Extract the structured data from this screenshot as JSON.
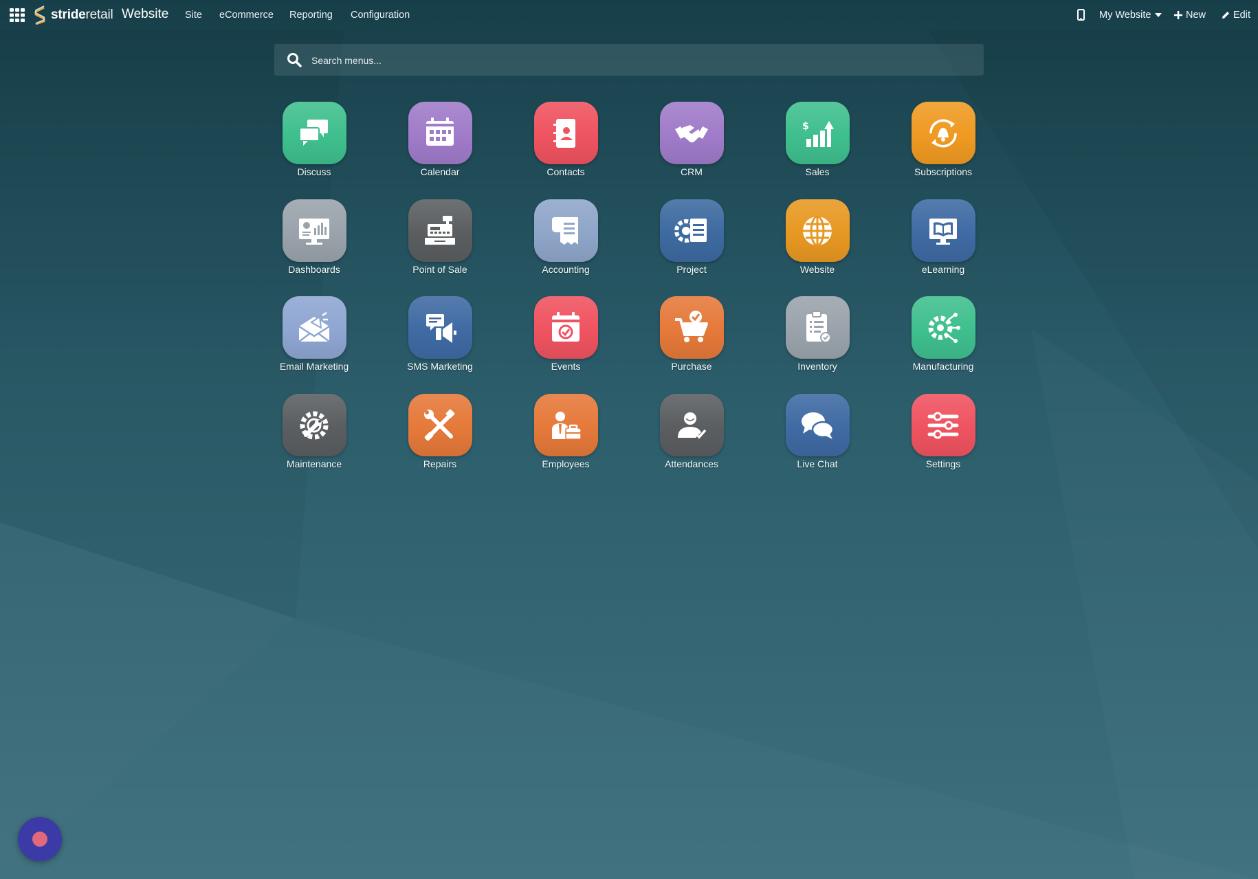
{
  "brand": {
    "logo_bold": "stride",
    "logo_light": "retail",
    "app_name": "Website"
  },
  "nav": [
    "Site",
    "eCommerce",
    "Reporting",
    "Configuration"
  ],
  "toolbar": {
    "website_label": "My Website",
    "new_label": "New",
    "edit_label": "Edit"
  },
  "search": {
    "placeholder": "Search menus...",
    "value": ""
  },
  "apps": [
    {
      "label": "Discuss",
      "color": "#3fbf8e",
      "icon": "chat-bubbles-icon"
    },
    {
      "label": "Calendar",
      "color": "#a07bc9",
      "icon": "calendar-icon"
    },
    {
      "label": "Contacts",
      "color": "#ef5360",
      "icon": "address-book-icon"
    },
    {
      "label": "CRM",
      "color": "#a07bc9",
      "icon": "handshake-icon"
    },
    {
      "label": "Sales",
      "color": "#3fbf8e",
      "icon": "sales-chart-icon"
    },
    {
      "label": "Subscriptions",
      "color": "#ef9a22",
      "icon": "bell-refresh-icon"
    },
    {
      "label": "Dashboards",
      "color": "#9aa3ab",
      "icon": "monitor-chart-icon"
    },
    {
      "label": "Point of Sale",
      "color": "#5a5e61",
      "icon": "cash-register-icon"
    },
    {
      "label": "Accounting",
      "color": "#8fa6c9",
      "icon": "receipt-icon"
    },
    {
      "label": "Project",
      "color": "#3d6aa0",
      "icon": "gear-document-icon"
    },
    {
      "label": "Website",
      "color": "#e89822",
      "icon": "globe-icon"
    },
    {
      "label": "eLearning",
      "color": "#3f6aa3",
      "icon": "book-monitor-icon"
    },
    {
      "label": "Email Marketing",
      "color": "#8ea6d2",
      "icon": "envelope-megaphone-icon"
    },
    {
      "label": "SMS Marketing",
      "color": "#3f6aa3",
      "icon": "sms-megaphone-icon"
    },
    {
      "label": "Events",
      "color": "#ef5360",
      "icon": "event-calendar-icon"
    },
    {
      "label": "Purchase",
      "color": "#e5793a",
      "icon": "cart-check-icon"
    },
    {
      "label": "Inventory",
      "color": "#9aa3ab",
      "icon": "clipboard-check-icon"
    },
    {
      "label": "Manufacturing",
      "color": "#3fbf8e",
      "icon": "gear-circuit-icon"
    },
    {
      "label": "Maintenance",
      "color": "#5a5e61",
      "icon": "wrench-gear-icon"
    },
    {
      "label": "Repairs",
      "color": "#e5793a",
      "icon": "tools-cross-icon"
    },
    {
      "label": "Employees",
      "color": "#e5793a",
      "icon": "employee-briefcase-icon"
    },
    {
      "label": "Attendances",
      "color": "#5a5e61",
      "icon": "person-check-icon"
    },
    {
      "label": "Live Chat",
      "color": "#3f6aa3",
      "icon": "live-chat-icon"
    },
    {
      "label": "Settings",
      "color": "#ef5360",
      "icon": "sliders-icon"
    }
  ]
}
